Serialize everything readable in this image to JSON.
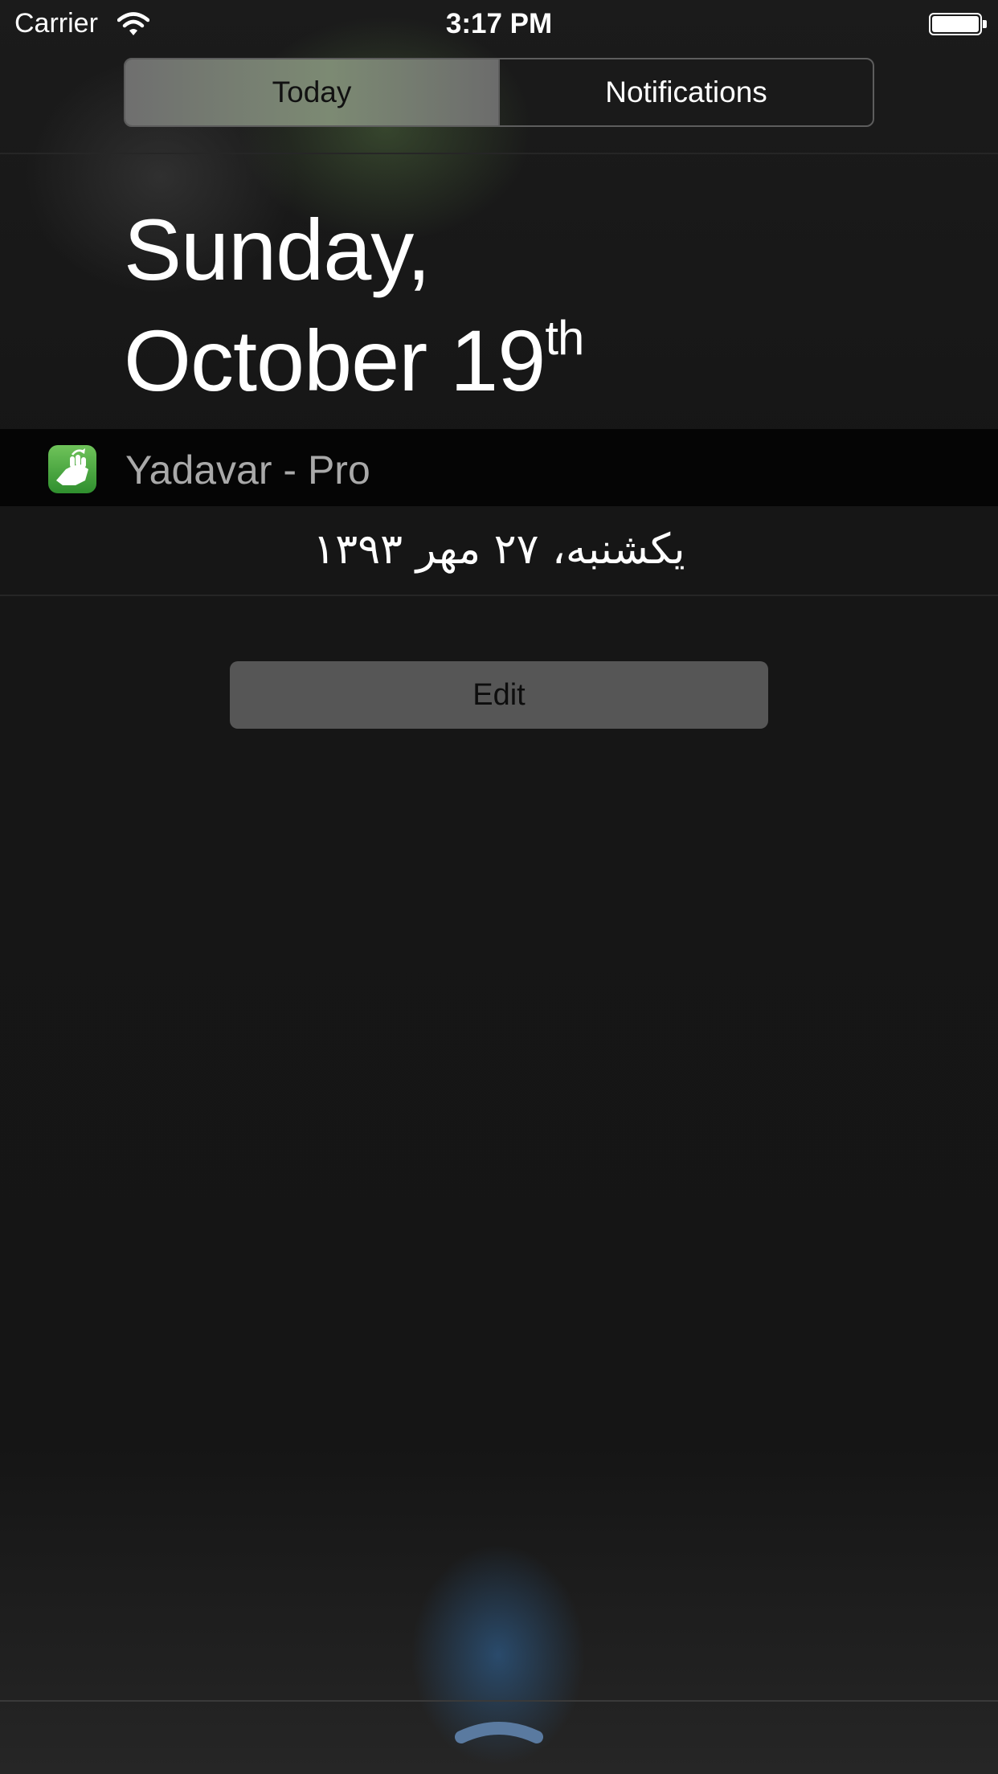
{
  "status_bar": {
    "carrier": "Carrier",
    "time": "3:17 PM",
    "wifi_icon": "wifi-icon",
    "battery_icon": "battery-icon"
  },
  "segmented_control": {
    "today_label": "Today",
    "notifications_label": "Notifications",
    "selected": "Today"
  },
  "date_heading": {
    "line1": "Sunday,",
    "line2": "October 19",
    "suffix": "th"
  },
  "widget": {
    "app_name": "Yadavar - Pro",
    "icon": "yadavar-app-icon",
    "persian_date": "یکشنبه، ۲۷ مهر ۱۳۹۳"
  },
  "edit_label": "Edit",
  "colors": {
    "background": "#161616",
    "segment_selected": "#7c8a73",
    "edit_button": "#565656",
    "app_icon_green": "#4caf3f",
    "grabber": "#5a7aa0"
  }
}
